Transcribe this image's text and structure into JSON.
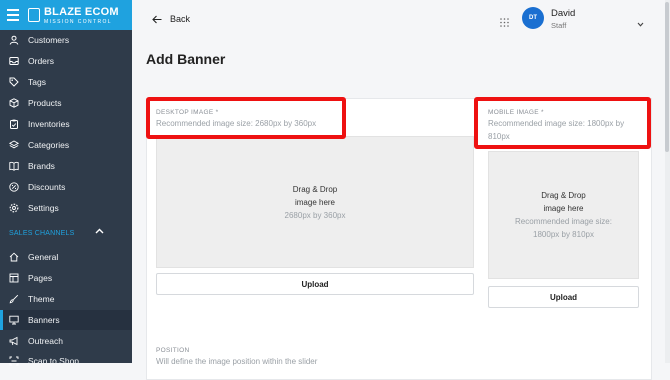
{
  "brand": {
    "name": "BLAZE ECOM",
    "tagline": "MISSION CONTROL"
  },
  "sidebar": {
    "items": [
      {
        "label": "Customers",
        "icon": "user-icon"
      },
      {
        "label": "Orders",
        "icon": "inbox-icon"
      },
      {
        "label": "Tags",
        "icon": "tag-icon"
      },
      {
        "label": "Products",
        "icon": "box-icon"
      },
      {
        "label": "Inventories",
        "icon": "clipboard-icon"
      },
      {
        "label": "Categories",
        "icon": "layers-icon"
      },
      {
        "label": "Brands",
        "icon": "book-icon"
      },
      {
        "label": "Discounts",
        "icon": "percent-icon"
      },
      {
        "label": "Settings",
        "icon": "gear-icon"
      }
    ],
    "section_label": "SALES CHANNELS",
    "channel_items": [
      {
        "label": "General",
        "icon": "home-icon"
      },
      {
        "label": "Pages",
        "icon": "layout-icon"
      },
      {
        "label": "Theme",
        "icon": "brush-icon"
      },
      {
        "label": "Banners",
        "icon": "monitor-icon",
        "active": true
      },
      {
        "label": "Outreach",
        "icon": "megaphone-icon"
      },
      {
        "label": "Scan to Shop",
        "icon": "scan-icon"
      }
    ],
    "accent_color": "#1fa2df"
  },
  "header": {
    "back_label": "Back",
    "user": {
      "initials": "DT",
      "name": "David",
      "role": "Staff"
    }
  },
  "page": {
    "title": "Add Banner"
  },
  "desktop_image": {
    "label": "DESKTOP IMAGE *",
    "hint": "Recommended image size: 2680px by 360px",
    "drop_line1": "Drag & Drop",
    "drop_line2": "image here",
    "drop_size": "2680px by 360px",
    "upload_label": "Upload"
  },
  "mobile_image": {
    "label": "MOBILE IMAGE *",
    "hint_line1": "Recommended image size: 1800px by",
    "hint_line2": "810px",
    "drop_line1": "Drag & Drop",
    "drop_line2": "image here",
    "drop_size_line1": "Recommended image size:",
    "drop_size_line2": "1800px by 810px",
    "upload_label": "Upload"
  },
  "position": {
    "label": "POSITION",
    "hint": "Will define the image position within the slider"
  },
  "highlight_color": "#ee1111"
}
